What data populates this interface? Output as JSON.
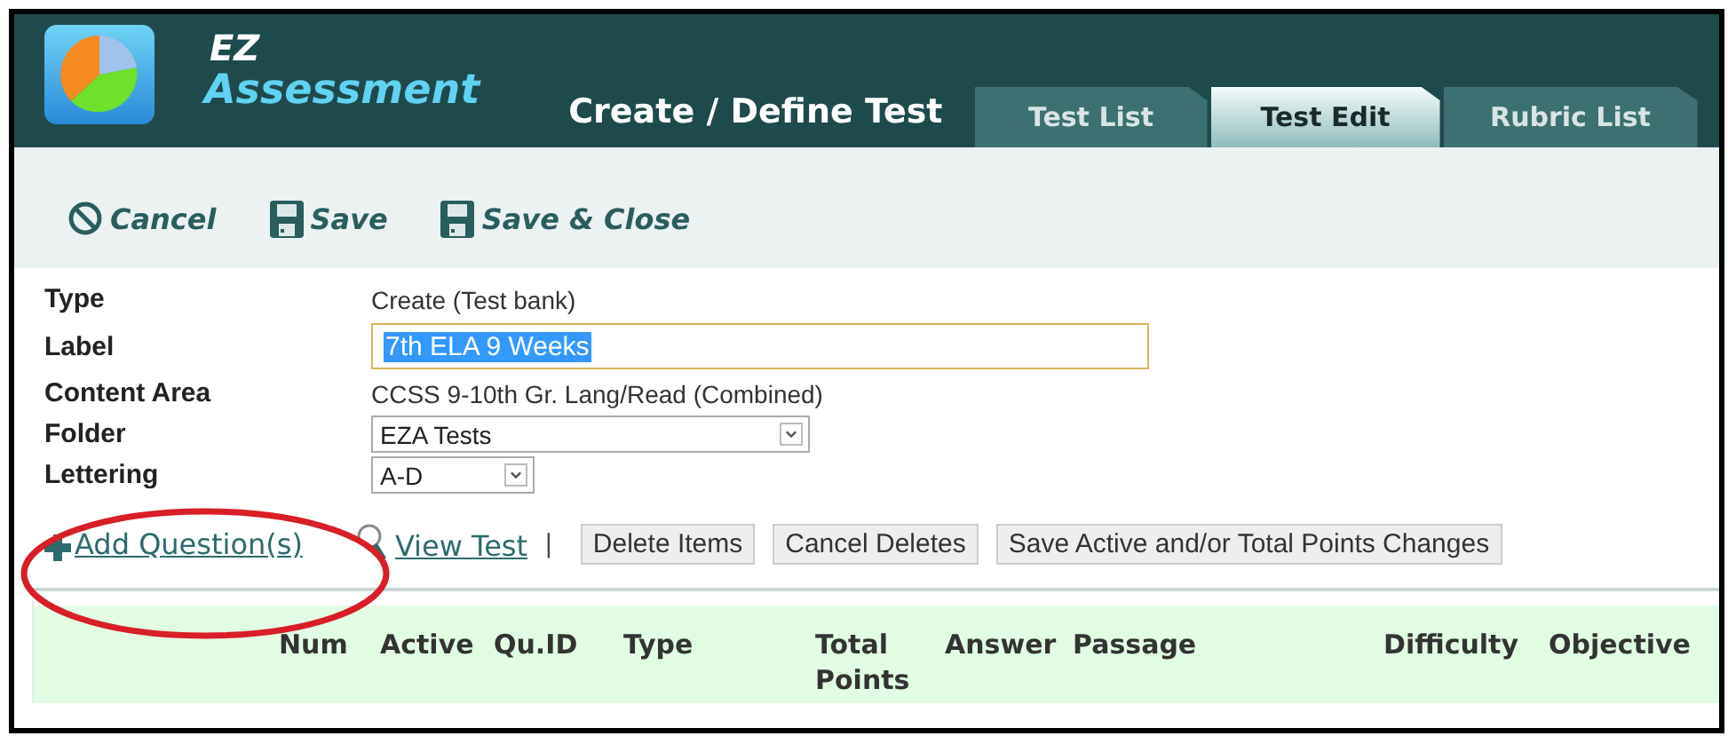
{
  "app": {
    "logo_top": "EZ",
    "logo_bottom": "Assessment"
  },
  "page_title": "Create / Define Test",
  "tabs": [
    {
      "label": "Test List",
      "selected": false
    },
    {
      "label": "Test Edit",
      "selected": true
    },
    {
      "label": "Rubric List",
      "selected": false
    }
  ],
  "toolbar": [
    {
      "kind": "cancel",
      "label": "Cancel"
    },
    {
      "kind": "save",
      "label": "Save"
    },
    {
      "kind": "save",
      "label": "Save & Close"
    }
  ],
  "form": [
    {
      "kind": "text",
      "label": "Type",
      "value": "Create (Test bank)"
    },
    {
      "kind": "input",
      "label": "Label",
      "value": "7th ELA 9 Weeks",
      "highlighted": true
    },
    {
      "kind": "text",
      "label": "Content Area",
      "value": "CCSS 9-10th Gr. Lang/Read (Combined)"
    },
    {
      "kind": "wide-select",
      "label": "Folder",
      "value": "EZA Tests"
    },
    {
      "kind": "narrow-select",
      "label": "Lettering",
      "value": "A-D"
    }
  ],
  "actions": [
    {
      "kind": "add-link",
      "label": "Add Question(s)"
    },
    {
      "kind": "view-link",
      "label": "View Test"
    },
    {
      "kind": "separator",
      "label": "|"
    },
    {
      "kind": "button",
      "label": "Delete Items"
    },
    {
      "kind": "button",
      "label": "Cancel Deletes"
    },
    {
      "kind": "button",
      "label": "Save Active and/or Total Points Changes"
    }
  ],
  "table": {
    "columns": [
      "Num",
      "Active",
      "Qu.ID",
      "Type",
      "Total Points",
      "Answer",
      "Passage",
      "Difficulty",
      "Objective"
    ]
  }
}
